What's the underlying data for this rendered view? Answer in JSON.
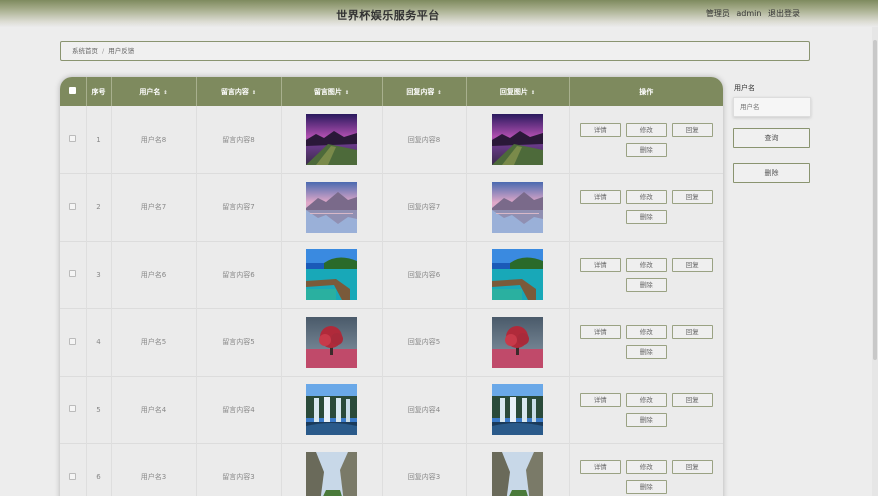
{
  "header": {
    "title": "世界杯娱乐服务平台",
    "user_role": "管理员",
    "username": "admin",
    "logout": "退出登录"
  },
  "breadcrumb": {
    "home": "系统首页",
    "separator": "/",
    "current": "用户反馈"
  },
  "table": {
    "columns": {
      "index": "序号",
      "username": "用户名",
      "message": "留言内容",
      "image": "留言图片",
      "reply": "回复内容",
      "reply_image": "回复图片",
      "actions": "操作"
    },
    "sort_icon": "⇕",
    "action_labels": {
      "detail": "详情",
      "edit": "修改",
      "reply": "回复",
      "delete": "删除"
    },
    "rows": [
      {
        "index": "1",
        "username": "用户名8",
        "message": "留言内容8",
        "reply": "回复内容8",
        "image": "purple-sunset-lake"
      },
      {
        "index": "2",
        "username": "用户名7",
        "message": "留言内容7",
        "reply": "回复内容7",
        "image": "mountain-lake-reflection"
      },
      {
        "index": "3",
        "username": "用户名6",
        "message": "留言内容6",
        "reply": "回复内容6",
        "image": "tropical-pier"
      },
      {
        "index": "4",
        "username": "用户名5",
        "message": "留言内容5",
        "reply": "回复内容5",
        "image": "pink-tree"
      },
      {
        "index": "5",
        "username": "用户名4",
        "message": "留言内容4",
        "reply": "回复内容4",
        "image": "waterfall"
      },
      {
        "index": "6",
        "username": "用户名3",
        "message": "留言内容3",
        "reply": "回复内容3",
        "image": "cliff-valley"
      }
    ]
  },
  "sidebar": {
    "username_label": "用户名",
    "username_placeholder": "用户名",
    "search_button": "查询",
    "delete_button": "删除"
  },
  "colors": {
    "accent": "#7e8a5e",
    "border": "#8a9470",
    "background": "#ededed"
  }
}
